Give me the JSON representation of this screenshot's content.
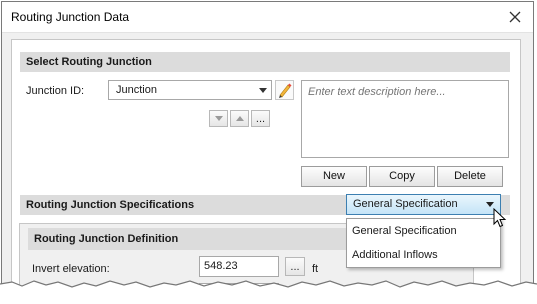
{
  "window": {
    "title": "Routing Junction Data"
  },
  "select_section": {
    "header": "Select Routing Junction",
    "junction_label": "Junction ID:",
    "junction_value": "Junction",
    "more_label": "...",
    "description_placeholder": "Enter text description here...",
    "buttons": {
      "new": "New",
      "copy": "Copy",
      "delete": "Delete"
    }
  },
  "spec_section": {
    "header": "Routing Junction Specifications",
    "selected": "General Specification",
    "options": [
      "General Specification",
      "Additional Inflows"
    ]
  },
  "definition": {
    "header": "Routing Junction Definition",
    "invert_label": "Invert elevation:",
    "invert_value": "548.23",
    "more_label": "...",
    "unit": "ft"
  },
  "colors": {
    "accent_border": "#3c7fb1",
    "accent_fill": "#c4e4f7",
    "section_header": "#dcdcdc"
  },
  "icons": [
    "close-icon",
    "pencil-icon",
    "chevron-down-icon",
    "chevron-up-icon",
    "mouse-cursor-icon"
  ]
}
